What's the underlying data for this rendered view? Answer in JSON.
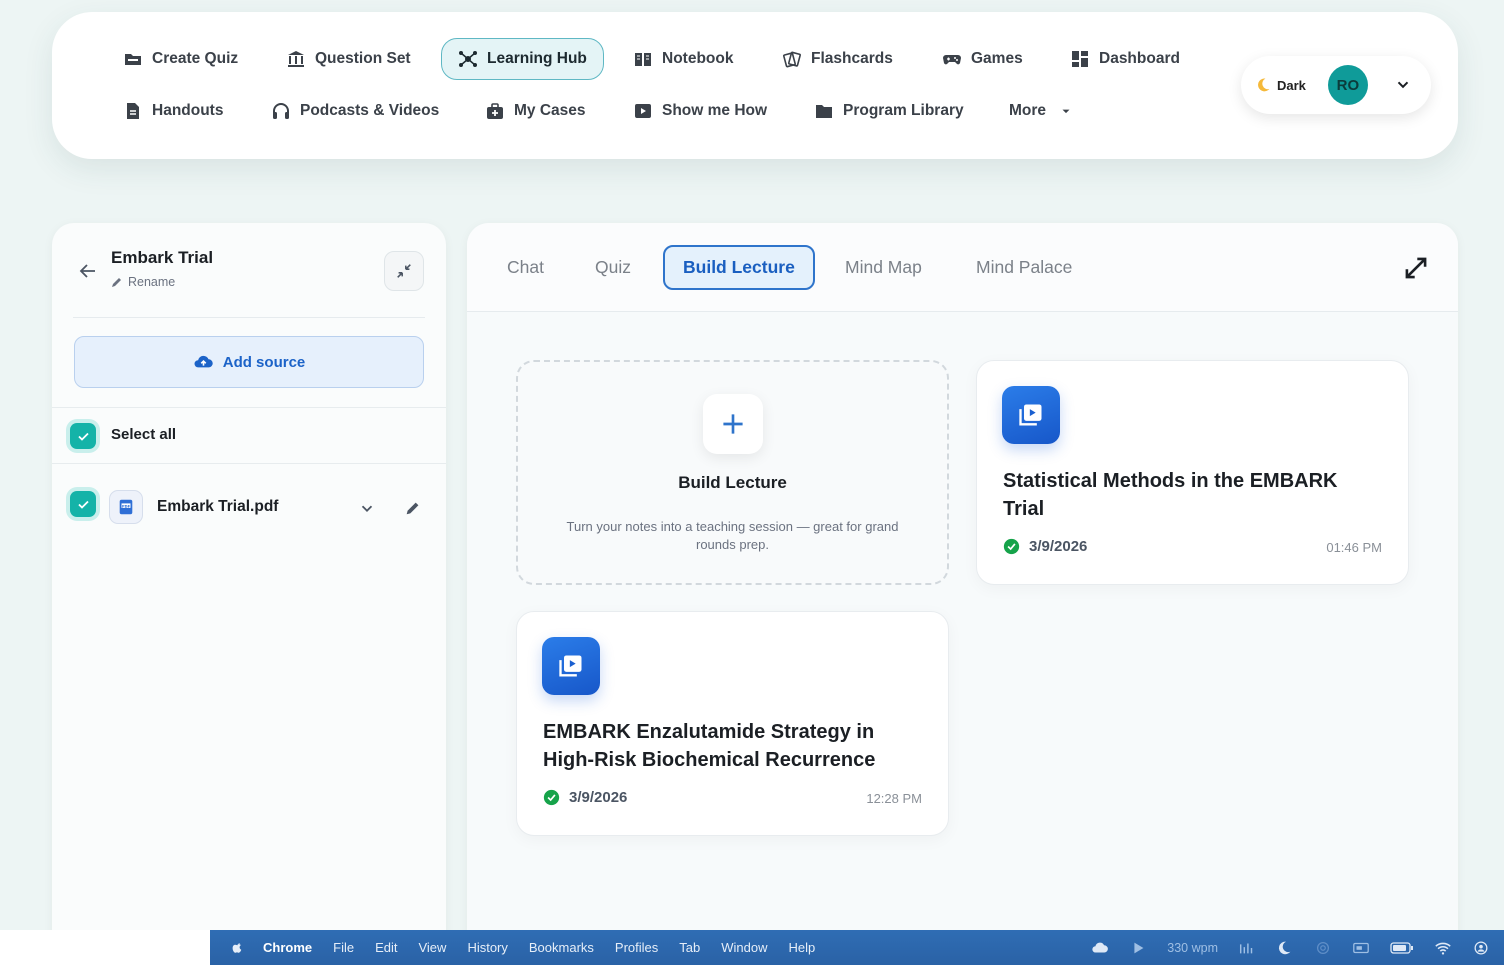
{
  "topnav": {
    "row1": [
      {
        "label": "Create Quiz",
        "icon": "folder-icon"
      },
      {
        "label": "Question Set",
        "icon": "bank-icon"
      },
      {
        "label": "Learning Hub",
        "icon": "network-icon",
        "active": true
      },
      {
        "label": "Notebook",
        "icon": "book-icon"
      },
      {
        "label": "Flashcards",
        "icon": "cards-icon"
      },
      {
        "label": "Games",
        "icon": "gamepad-icon"
      },
      {
        "label": "Dashboard",
        "icon": "dashboard-icon"
      }
    ],
    "row2": [
      {
        "label": "Handouts",
        "icon": "document-icon"
      },
      {
        "label": "Podcasts & Videos",
        "icon": "headphones-icon"
      },
      {
        "label": "My Cases",
        "icon": "medical-case-icon"
      },
      {
        "label": "Show me How",
        "icon": "play-icon"
      },
      {
        "label": "Program Library",
        "icon": "folder-icon"
      },
      {
        "label": "More",
        "icon": "caret-down-icon"
      }
    ]
  },
  "account": {
    "theme_label": "Dark",
    "avatar_initials": "RO"
  },
  "sidebar": {
    "notebook_title": "Embark Trial",
    "rename_label": "Rename",
    "add_source_label": "Add source",
    "select_all_label": "Select all",
    "files": [
      {
        "name": "Embark Trial.pdf",
        "checked": true
      }
    ]
  },
  "tabs": [
    {
      "label": "Chat"
    },
    {
      "label": "Quiz"
    },
    {
      "label": "Build Lecture",
      "active": true
    },
    {
      "label": "Mind Map"
    },
    {
      "label": "Mind Palace"
    }
  ],
  "build_card": {
    "title": "Build Lecture",
    "description": "Turn your notes into a teaching session — great for grand rounds prep."
  },
  "lectures": [
    {
      "title": "Statistical Methods in the EMBARK Trial",
      "date": "3/9/2026",
      "time": "01:46 PM"
    },
    {
      "title": "EMBARK Enzalutamide Strategy in High-Risk Biochemical Recurrence",
      "date": "3/9/2026",
      "time": "12:28 PM"
    }
  ],
  "menubar": {
    "app": "Chrome",
    "items": [
      "File",
      "Edit",
      "View",
      "History",
      "Bookmarks",
      "Profiles",
      "Tab",
      "Window",
      "Help"
    ],
    "wpm": "330 wpm"
  },
  "colors": {
    "accent_teal": "#14b3a8",
    "accent_blue": "#1c63c8",
    "success_green": "#16a34a"
  }
}
